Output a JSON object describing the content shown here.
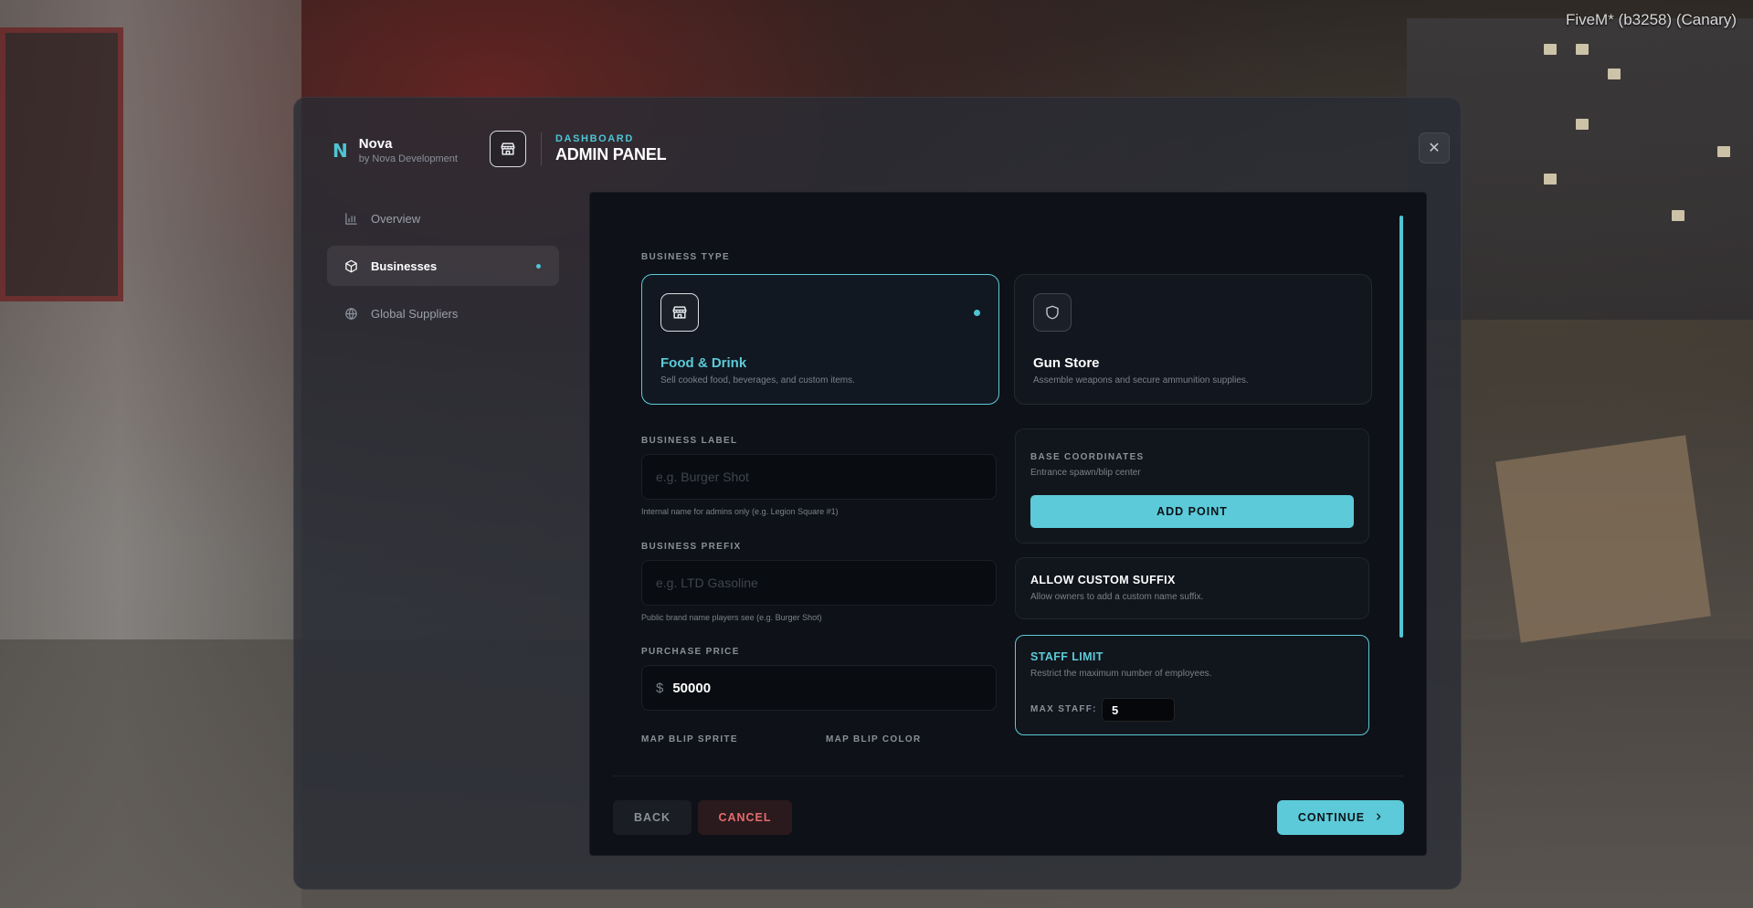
{
  "overlay": {
    "fivem_tag": "FiveM* (b3258) (Canary)"
  },
  "brand": {
    "name": "Nova",
    "sub": "by Nova Development",
    "logo": "N"
  },
  "header": {
    "kicker": "DASHBOARD",
    "title": "ADMIN PANEL",
    "icon": "store-icon"
  },
  "nav": {
    "items": [
      {
        "label": "Overview",
        "icon": "bar-chart-icon",
        "active": false
      },
      {
        "label": "Businesses",
        "icon": "cube-icon",
        "active": true
      },
      {
        "label": "Global Suppliers",
        "icon": "globe-icon",
        "active": false
      }
    ]
  },
  "form": {
    "business_type_label": "BUSINESS TYPE",
    "types": [
      {
        "title": "Food & Drink",
        "desc": "Sell cooked food, beverages, and custom items.",
        "icon": "store-icon",
        "selected": true
      },
      {
        "title": "Gun Store",
        "desc": "Assemble weapons and secure ammunition supplies.",
        "icon": "shield-icon",
        "selected": false
      }
    ],
    "business_label": {
      "label": "BUSINESS LABEL",
      "placeholder": "e.g. Burger Shot",
      "hint": "Internal name for admins only (e.g. Legion Square #1)"
    },
    "business_prefix": {
      "label": "BUSINESS PREFIX",
      "placeholder": "e.g. LTD Gasoline",
      "hint": "Public brand name players see (e.g. Burger Shot)"
    },
    "purchase_price": {
      "label": "PURCHASE PRICE",
      "currency": "$",
      "value": "50000"
    },
    "map_blip_sprite_label": "MAP BLIP SPRITE",
    "map_blip_color_label": "MAP BLIP COLOR",
    "base_coordinates": {
      "kicker": "BASE COORDINATES",
      "sub": "Entrance spawn/blip center",
      "button": "ADD POINT"
    },
    "custom_suffix": {
      "title": "ALLOW CUSTOM SUFFIX",
      "sub": "Allow owners to add a custom name suffix."
    },
    "staff_limit": {
      "title": "STAFF LIMIT",
      "sub": "Restrict the maximum number of employees.",
      "max_label": "MAX STAFF:",
      "max_value": "5"
    }
  },
  "footer": {
    "back": "BACK",
    "cancel": "CANCEL",
    "continue": "CONTINUE"
  },
  "colors": {
    "accent": "#5ccad8",
    "danger": "#e46c6c",
    "modal_bg": "#0e1118"
  }
}
